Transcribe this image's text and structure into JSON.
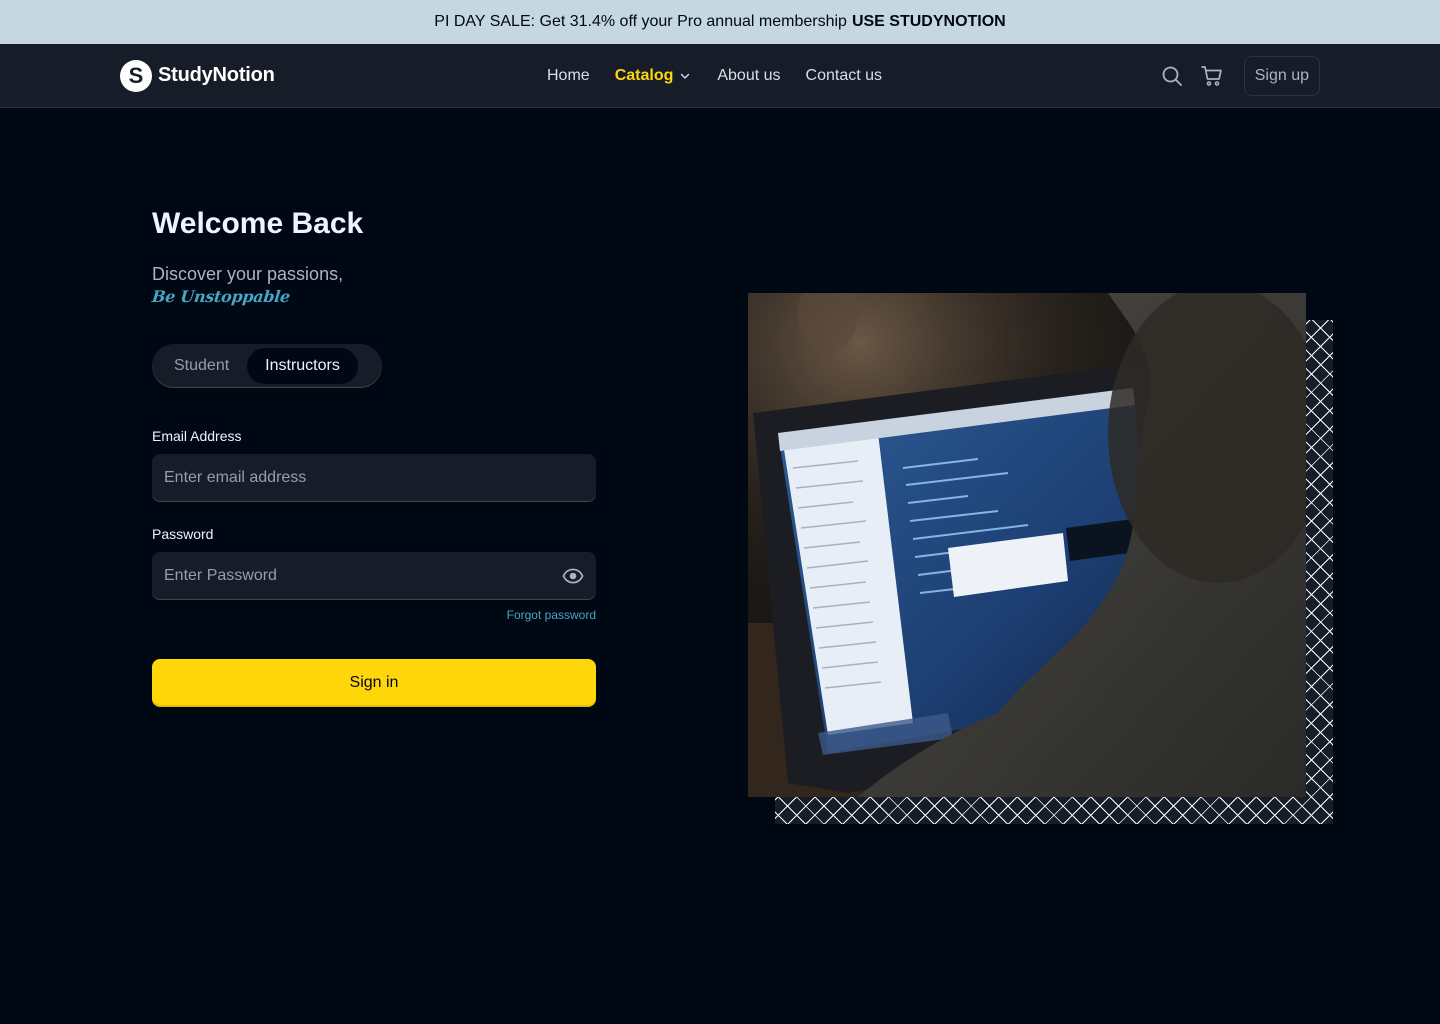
{
  "banner": {
    "text": "PI DAY SALE: Get 31.4% off your Pro annual membership",
    "code": "USE STUDYNOTION"
  },
  "nav": {
    "logo_letter": "S",
    "brand": "StudyNotion",
    "links": {
      "home": "Home",
      "catalog": "Catalog",
      "about": "About us",
      "contact": "Contact us"
    },
    "signup": "Sign up"
  },
  "login": {
    "title": "Welcome Back",
    "subtitle": "Discover your passions,",
    "tagline": "Be Unstoppable",
    "roles": {
      "student": "Student",
      "instructor": "Instructors",
      "selected": "Instructors"
    },
    "email_label": "Email Address",
    "email_placeholder": "Enter email address",
    "password_label": "Password",
    "password_placeholder": "Enter Password",
    "forgot": "Forgot password",
    "submit": "Sign in"
  },
  "colors": {
    "background": "#000814",
    "accent_yellow": "#FFD60A",
    "link_blue": "#47A5C5",
    "banner_bg": "#C5D7E0"
  },
  "icons": [
    "search-icon",
    "cart-icon",
    "chevron-down-icon",
    "eye-icon"
  ]
}
